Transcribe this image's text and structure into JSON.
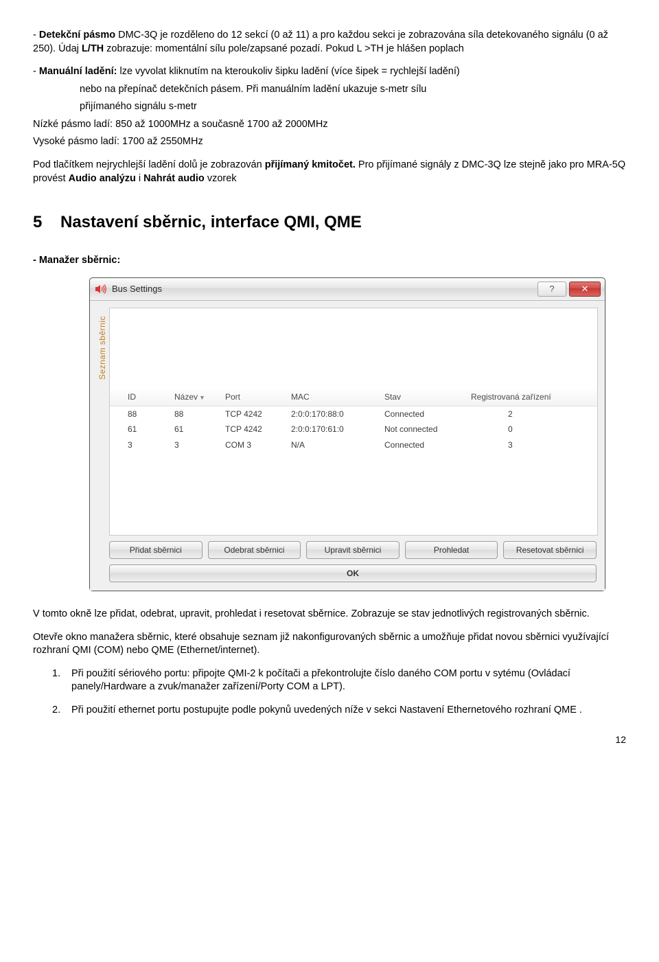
{
  "doc": {
    "p1_a": "- ",
    "p1_b": "Detekční pásmo",
    "p1_c": " DMC-3Q je rozděleno do 12 sekcí (0 až 11) a pro každou sekci je zobrazována síla detekovaného signálu (0 až 250). Údaj ",
    "p1_d": "L/TH",
    "p1_e": " zobrazuje: momentální sílu pole/zapsané pozadí. Pokud L >TH je hlášen poplach",
    "p2_a": "- ",
    "p2_b": "Manuální ladění:",
    "p2_c": " lze vyvolat kliknutím na kteroukoliv šipku ladění (více šipek = rychlejší ladění)",
    "p2_indent1": "nebo na přepínač detekčních pásem. Při manuálním ladění ukazuje  s-metr sílu",
    "p2_indent2": "přijímaného signálu s-metr",
    "p3": "Nízké pásmo ladí: 850 až 1000MHz  a současně 1700 až 2000MHz",
    "p4": "Vysoké pásmo ladí: 1700 až 2550MHz",
    "p5_a": "Pod tlačítkem nejrychlejší ladění dolů je zobrazován ",
    "p5_b": "přijímaný kmitočet.",
    "p5_c": " Pro přijímané signály z DMC-3Q lze stejně jako pro MRA-5Q provést ",
    "p5_d": "Audio analýzu",
    "p5_e": " i ",
    "p5_f": "Nahrát audio",
    "p5_g": " vzorek",
    "heading_num": "5",
    "heading_txt": "Nastavení sběrnic, interface QMI, QME",
    "p6": "- Manažer sběrnic:",
    "p7": "V tomto okně lze přidat, odebrat, upravit, prohledat i resetovat sběrnice. Zobrazuje se stav jednotlivých  registrovaných sběrnic.",
    "p8": "Otevře okno manažera sběrnic, které obsahuje seznam již nakonfigurovaných sběrnic a umožňuje přidat novou sběrnici využívající rozhraní QMI (COM) nebo QME (Ethernet/internet).",
    "li1_n": "1.",
    "li1_t": "Při použití sériového portu: připojte QMI-2 k počítači a překontrolujte číslo daného COM portu v sytému  (Ovládací panely/Hardware a zvuk/manažer zařízení/Porty COM a LPT).",
    "li2_n": "2.",
    "li2_t": "Při použití ethernet portu postupujte podle pokynů uvedených níže v sekci Nastavení Ethernetového rozhraní QME .",
    "page_number": "12"
  },
  "window": {
    "title": "Bus Settings",
    "sidebar_label": "Seznam sběrnic",
    "columns": {
      "id": "ID",
      "name": "Název",
      "port": "Port",
      "mac": "MAC",
      "stav": "Stav",
      "reg": "Registrovaná zařízení"
    },
    "rows": [
      {
        "id": "88",
        "name": "88",
        "port": "TCP 4242",
        "mac": "2:0:0:170:88:0",
        "stav": "Connected",
        "reg": "2"
      },
      {
        "id": "61",
        "name": "61",
        "port": "TCP 4242",
        "mac": "2:0:0:170:61:0",
        "stav": "Not connected",
        "reg": "0"
      },
      {
        "id": "3",
        "name": "3",
        "port": "COM 3",
        "mac": "N/A",
        "stav": "Connected",
        "reg": "3"
      }
    ],
    "buttons": {
      "add": "Přidat sběrnici",
      "remove": "Odebrat sběrnici",
      "edit": "Upravit sběrnici",
      "scan": "Prohledat",
      "reset": "Resetovat sběrnici",
      "ok": "OK"
    },
    "help_glyph": "?",
    "close_glyph": "✕"
  }
}
